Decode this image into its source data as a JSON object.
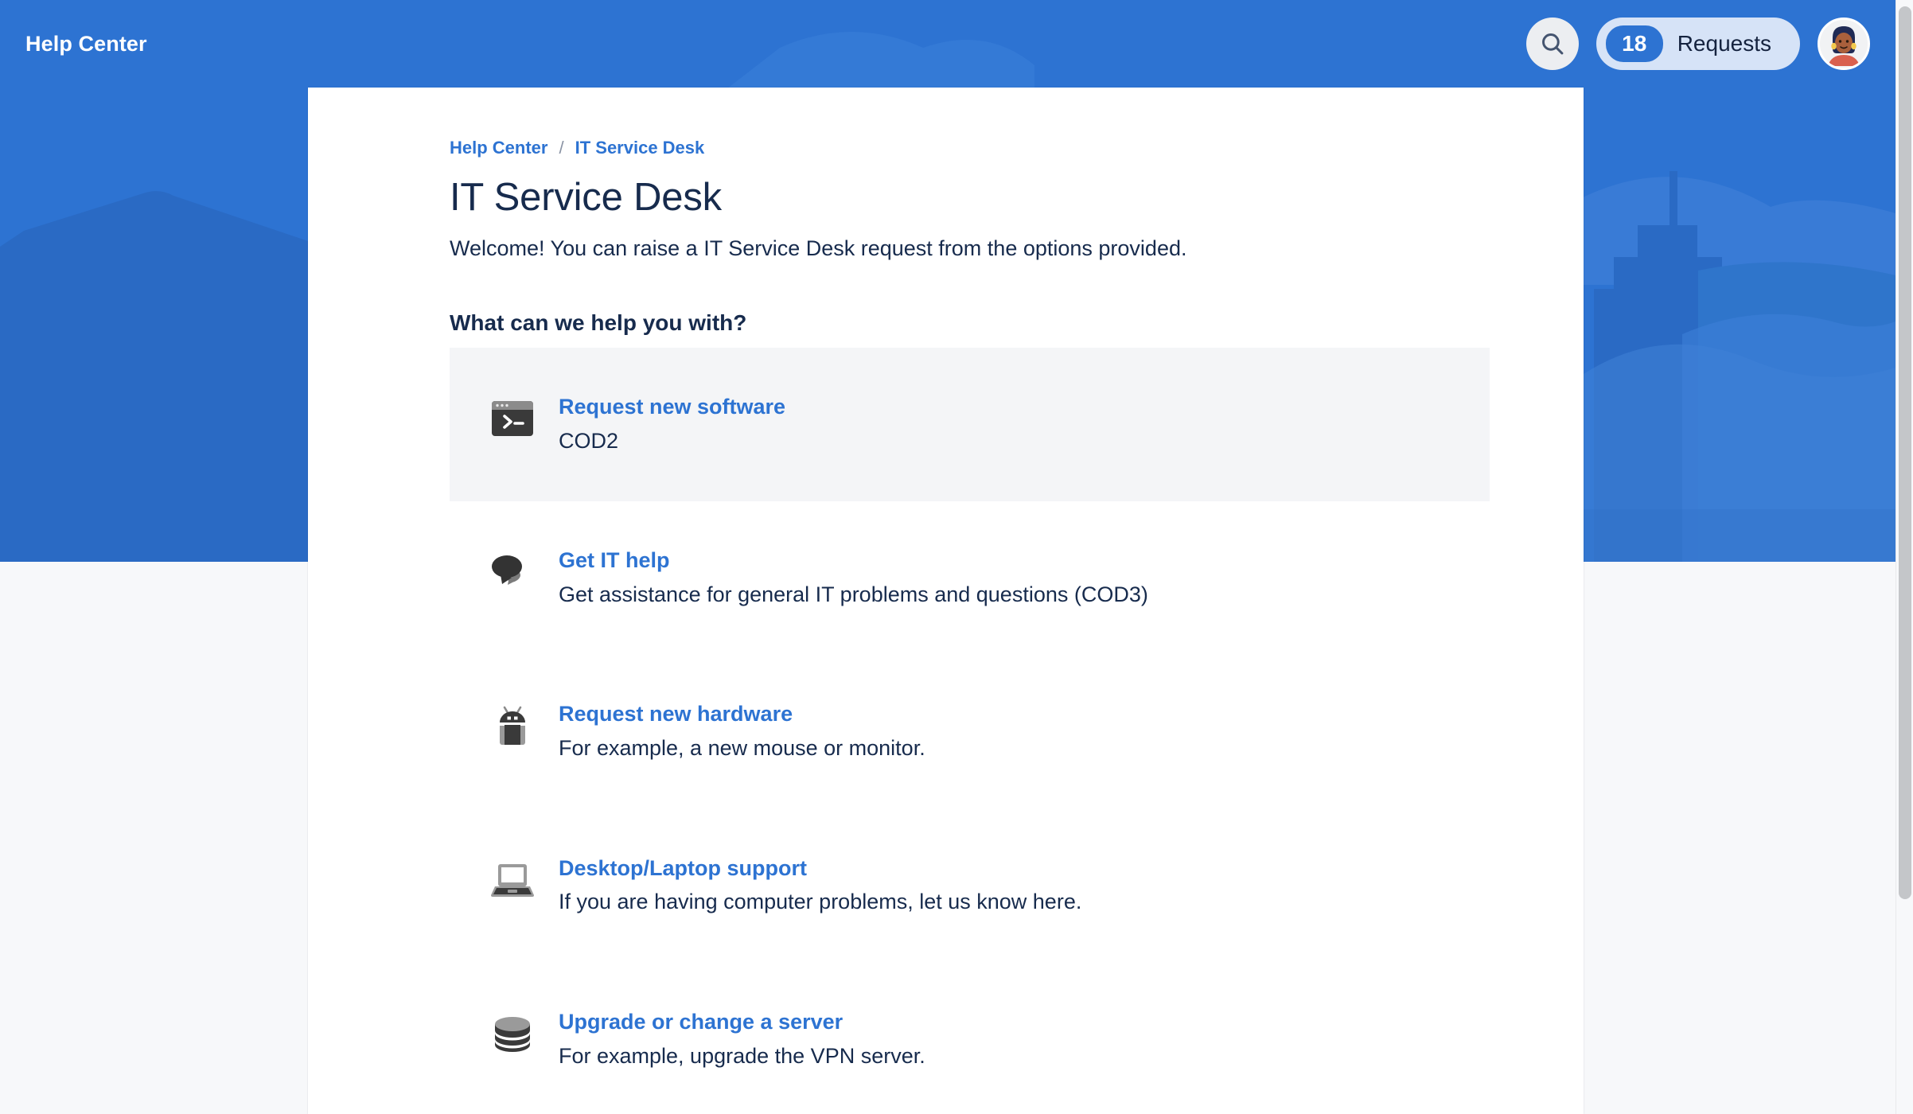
{
  "header": {
    "brand": "Help Center",
    "search_icon": "search-icon",
    "requests": {
      "count": "18",
      "label": "Requests"
    },
    "avatar": "user-avatar"
  },
  "breadcrumb": {
    "items": [
      "Help Center",
      "IT Service Desk"
    ],
    "separator": "/"
  },
  "page": {
    "title": "IT Service Desk",
    "description": "Welcome! You can raise a IT Service Desk request from the options provided.",
    "section_title": "What can we help you with?"
  },
  "requests": [
    {
      "icon": "terminal-icon",
      "title": "Request new software",
      "desc": "COD2",
      "highlighted": true
    },
    {
      "icon": "speech-bubbles-icon",
      "title": "Get IT help",
      "desc": "Get assistance for general IT problems and questions (COD3)",
      "highlighted": false
    },
    {
      "icon": "robot-icon",
      "title": "Request new hardware",
      "desc": "For example, a new mouse or monitor.",
      "highlighted": false
    },
    {
      "icon": "laptop-icon",
      "title": "Desktop/Laptop support",
      "desc": "If you are having computer problems, let us know here.",
      "highlighted": false
    },
    {
      "icon": "database-icon",
      "title": "Upgrade or change a server",
      "desc": "For example, upgrade the VPN server.",
      "highlighted": false
    }
  ],
  "colors": {
    "banner_blue": "#2d73d2",
    "link_blue": "#2d73d2",
    "text_dark": "#172b4d",
    "highlight_bg": "#f4f5f7",
    "page_bg": "#f7f8fa",
    "badge_blue": "#2d73d2",
    "pill_bg": "#d6e3f7"
  }
}
